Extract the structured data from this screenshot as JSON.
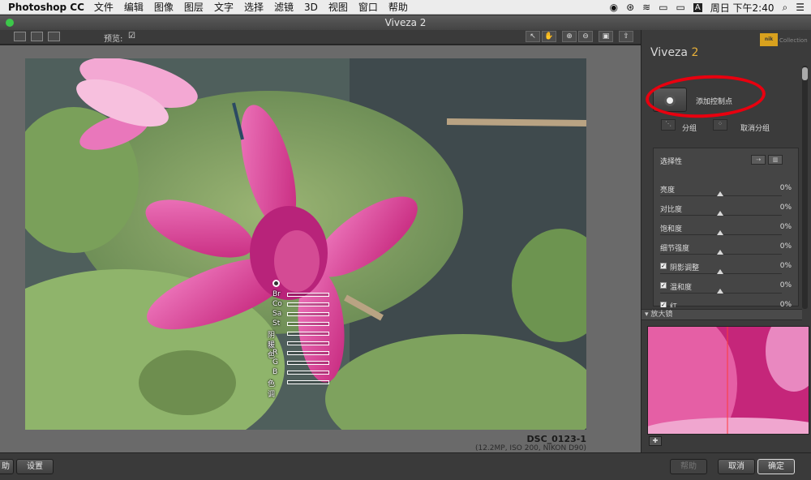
{
  "menubar": {
    "app": "Photoshop CC",
    "items": [
      "文件",
      "编辑",
      "图像",
      "图层",
      "文字",
      "选择",
      "滤镜",
      "3D",
      "视图",
      "窗口",
      "帮助"
    ],
    "clock": "周日 下午2:40",
    "input_source": "A"
  },
  "window": {
    "title": "Viveza 2"
  },
  "toolbar": {
    "preview_label": "预览:"
  },
  "photo": {
    "filename": "DSC_0123-1",
    "meta": "(12.2MP, ISO 200, NIKON D90)"
  },
  "control_point": {
    "labels": [
      "Br",
      "Co",
      "Sa",
      "St",
      "阴影",
      "暖色",
      "R",
      "G",
      "B",
      "色调"
    ]
  },
  "sidebar": {
    "title_prefix": "Viveza",
    "title_num": "2",
    "brand_badge": "nik",
    "brand_text": "Collection",
    "add_cp_label": "添加控制点",
    "group_label": "分组",
    "ungroup_label": "取消分组",
    "panel_title": "选择性",
    "sliders": [
      {
        "label": "亮度",
        "value": "0%",
        "check": false
      },
      {
        "label": "对比度",
        "value": "0%",
        "check": false
      },
      {
        "label": "饱和度",
        "value": "0%",
        "check": false
      },
      {
        "label": "细节强度",
        "value": "0%",
        "check": false
      },
      {
        "label": "阴影调整",
        "value": "0%",
        "check": true
      },
      {
        "label": "温和度",
        "value": "0%",
        "check": true
      },
      {
        "label": "红",
        "value": "0%",
        "check": true
      }
    ],
    "magnifier_label": "放大镜"
  },
  "bottom": {
    "left_partial": "助",
    "settings": "设置",
    "disabled_btn": "帮助",
    "cancel": "取消",
    "ok": "确定"
  },
  "colors": {
    "annotation_red": "#e8000f",
    "accent_yellow": "#e8b03a"
  }
}
